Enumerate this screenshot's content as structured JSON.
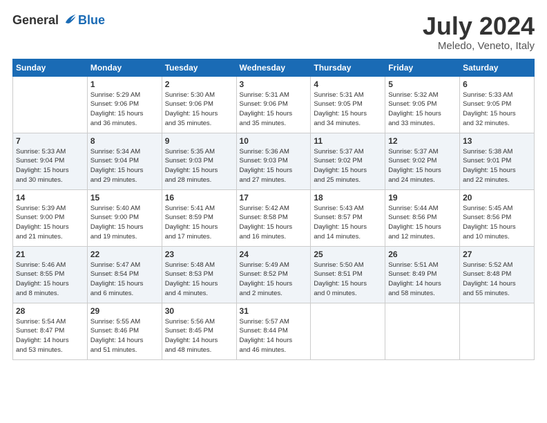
{
  "logo": {
    "general": "General",
    "blue": "Blue"
  },
  "title": "July 2024",
  "location": "Meledo, Veneto, Italy",
  "headers": [
    "Sunday",
    "Monday",
    "Tuesday",
    "Wednesday",
    "Thursday",
    "Friday",
    "Saturday"
  ],
  "weeks": [
    [
      {
        "num": "",
        "info": ""
      },
      {
        "num": "1",
        "info": "Sunrise: 5:29 AM\nSunset: 9:06 PM\nDaylight: 15 hours\nand 36 minutes."
      },
      {
        "num": "2",
        "info": "Sunrise: 5:30 AM\nSunset: 9:06 PM\nDaylight: 15 hours\nand 35 minutes."
      },
      {
        "num": "3",
        "info": "Sunrise: 5:31 AM\nSunset: 9:06 PM\nDaylight: 15 hours\nand 35 minutes."
      },
      {
        "num": "4",
        "info": "Sunrise: 5:31 AM\nSunset: 9:05 PM\nDaylight: 15 hours\nand 34 minutes."
      },
      {
        "num": "5",
        "info": "Sunrise: 5:32 AM\nSunset: 9:05 PM\nDaylight: 15 hours\nand 33 minutes."
      },
      {
        "num": "6",
        "info": "Sunrise: 5:33 AM\nSunset: 9:05 PM\nDaylight: 15 hours\nand 32 minutes."
      }
    ],
    [
      {
        "num": "7",
        "info": "Sunrise: 5:33 AM\nSunset: 9:04 PM\nDaylight: 15 hours\nand 30 minutes."
      },
      {
        "num": "8",
        "info": "Sunrise: 5:34 AM\nSunset: 9:04 PM\nDaylight: 15 hours\nand 29 minutes."
      },
      {
        "num": "9",
        "info": "Sunrise: 5:35 AM\nSunset: 9:03 PM\nDaylight: 15 hours\nand 28 minutes."
      },
      {
        "num": "10",
        "info": "Sunrise: 5:36 AM\nSunset: 9:03 PM\nDaylight: 15 hours\nand 27 minutes."
      },
      {
        "num": "11",
        "info": "Sunrise: 5:37 AM\nSunset: 9:02 PM\nDaylight: 15 hours\nand 25 minutes."
      },
      {
        "num": "12",
        "info": "Sunrise: 5:37 AM\nSunset: 9:02 PM\nDaylight: 15 hours\nand 24 minutes."
      },
      {
        "num": "13",
        "info": "Sunrise: 5:38 AM\nSunset: 9:01 PM\nDaylight: 15 hours\nand 22 minutes."
      }
    ],
    [
      {
        "num": "14",
        "info": "Sunrise: 5:39 AM\nSunset: 9:00 PM\nDaylight: 15 hours\nand 21 minutes."
      },
      {
        "num": "15",
        "info": "Sunrise: 5:40 AM\nSunset: 9:00 PM\nDaylight: 15 hours\nand 19 minutes."
      },
      {
        "num": "16",
        "info": "Sunrise: 5:41 AM\nSunset: 8:59 PM\nDaylight: 15 hours\nand 17 minutes."
      },
      {
        "num": "17",
        "info": "Sunrise: 5:42 AM\nSunset: 8:58 PM\nDaylight: 15 hours\nand 16 minutes."
      },
      {
        "num": "18",
        "info": "Sunrise: 5:43 AM\nSunset: 8:57 PM\nDaylight: 15 hours\nand 14 minutes."
      },
      {
        "num": "19",
        "info": "Sunrise: 5:44 AM\nSunset: 8:56 PM\nDaylight: 15 hours\nand 12 minutes."
      },
      {
        "num": "20",
        "info": "Sunrise: 5:45 AM\nSunset: 8:56 PM\nDaylight: 15 hours\nand 10 minutes."
      }
    ],
    [
      {
        "num": "21",
        "info": "Sunrise: 5:46 AM\nSunset: 8:55 PM\nDaylight: 15 hours\nand 8 minutes."
      },
      {
        "num": "22",
        "info": "Sunrise: 5:47 AM\nSunset: 8:54 PM\nDaylight: 15 hours\nand 6 minutes."
      },
      {
        "num": "23",
        "info": "Sunrise: 5:48 AM\nSunset: 8:53 PM\nDaylight: 15 hours\nand 4 minutes."
      },
      {
        "num": "24",
        "info": "Sunrise: 5:49 AM\nSunset: 8:52 PM\nDaylight: 15 hours\nand 2 minutes."
      },
      {
        "num": "25",
        "info": "Sunrise: 5:50 AM\nSunset: 8:51 PM\nDaylight: 15 hours\nand 0 minutes."
      },
      {
        "num": "26",
        "info": "Sunrise: 5:51 AM\nSunset: 8:49 PM\nDaylight: 14 hours\nand 58 minutes."
      },
      {
        "num": "27",
        "info": "Sunrise: 5:52 AM\nSunset: 8:48 PM\nDaylight: 14 hours\nand 55 minutes."
      }
    ],
    [
      {
        "num": "28",
        "info": "Sunrise: 5:54 AM\nSunset: 8:47 PM\nDaylight: 14 hours\nand 53 minutes."
      },
      {
        "num": "29",
        "info": "Sunrise: 5:55 AM\nSunset: 8:46 PM\nDaylight: 14 hours\nand 51 minutes."
      },
      {
        "num": "30",
        "info": "Sunrise: 5:56 AM\nSunset: 8:45 PM\nDaylight: 14 hours\nand 48 minutes."
      },
      {
        "num": "31",
        "info": "Sunrise: 5:57 AM\nSunset: 8:44 PM\nDaylight: 14 hours\nand 46 minutes."
      },
      {
        "num": "",
        "info": ""
      },
      {
        "num": "",
        "info": ""
      },
      {
        "num": "",
        "info": ""
      }
    ]
  ]
}
